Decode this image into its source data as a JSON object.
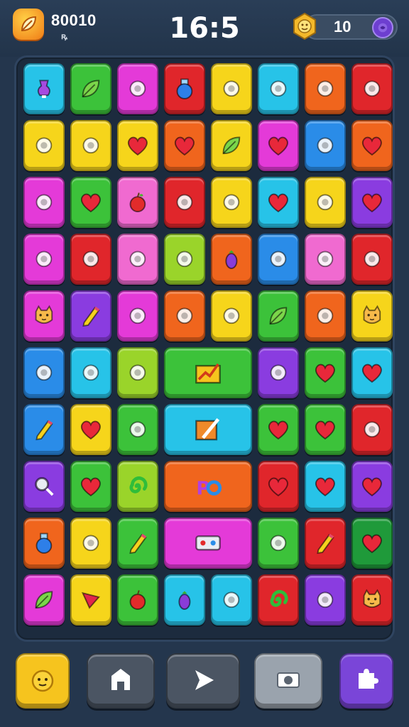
{
  "header": {
    "score": "80010",
    "score_sub": "ꝶ",
    "timer": "16:5",
    "coins": "10",
    "logo_icon": "leaf-logo-icon",
    "coin_icon": "star-medal-icon",
    "add_icon": "add-coins-icon"
  },
  "tile_colors": {
    "cyan": "#27c3e8",
    "green": "#3cc23a",
    "magenta": "#e43ad8",
    "red": "#e0262b",
    "yellow": "#f6d51b",
    "blue": "#2a8ce8",
    "orange": "#f0651d",
    "purple": "#8a3ce0",
    "pink": "#f06ad0",
    "lime": "#9ad42a",
    "gray": "#9aa3ad",
    "darkgreen": "#1f9a3a"
  },
  "grid": [
    [
      {
        "c": "cyan",
        "i": "potion-icon"
      },
      {
        "c": "green",
        "i": "leaf-icon"
      },
      {
        "c": "magenta",
        "i": "bell-pepper-icon"
      },
      {
        "c": "red",
        "i": "bottle-icon"
      },
      {
        "c": "yellow",
        "i": "clover-icon"
      },
      {
        "c": "cyan",
        "i": "boot-icon"
      },
      {
        "c": "orange",
        "i": "lime-icon"
      },
      {
        "c": "red",
        "i": "feather-icon"
      }
    ],
    [
      {
        "c": "yellow",
        "i": "lion-icon"
      },
      {
        "c": "yellow",
        "i": "bird-icon"
      },
      {
        "c": "yellow",
        "i": "heart-icon"
      },
      {
        "c": "orange",
        "i": "heart-icon"
      },
      {
        "c": "yellow",
        "i": "leaf-icon"
      },
      {
        "c": "magenta",
        "i": "heart-icon"
      },
      {
        "c": "blue",
        "i": "cake-slice-icon"
      },
      {
        "c": "orange",
        "i": "heart-icon"
      }
    ],
    [
      {
        "c": "magenta",
        "i": "brush-icon"
      },
      {
        "c": "green",
        "i": "heart-icon"
      },
      {
        "c": "pink",
        "i": "apple-icon"
      },
      {
        "c": "red",
        "i": "blueberry-icon"
      },
      {
        "c": "yellow",
        "i": "pot-icon"
      },
      {
        "c": "cyan",
        "i": "heart-icon"
      },
      {
        "c": "yellow",
        "i": "popsicle-icon"
      },
      {
        "c": "purple",
        "i": "heart-icon"
      }
    ],
    [
      {
        "c": "magenta",
        "i": "jar-icon"
      },
      {
        "c": "red",
        "i": "house-icon"
      },
      {
        "c": "pink",
        "i": "face-icon"
      },
      {
        "c": "lime",
        "i": "radish-icon"
      },
      {
        "c": "orange",
        "i": "eggplant-icon"
      },
      {
        "c": "blue",
        "i": "battery-icon"
      },
      {
        "c": "pink",
        "i": "crown-box-icon"
      },
      {
        "c": "red",
        "i": "lemon-icon"
      }
    ],
    [
      {
        "c": "magenta",
        "i": "cat-icon"
      },
      {
        "c": "purple",
        "i": "pencil-icon"
      },
      {
        "c": "magenta",
        "i": "wand-icon"
      },
      {
        "c": "orange",
        "i": "fish-icon"
      },
      {
        "c": "yellow",
        "i": "pepper-icon"
      },
      {
        "c": "green",
        "i": "leaf-icon"
      },
      {
        "c": "orange",
        "i": "phone-icon"
      },
      {
        "c": "yellow",
        "i": "cat-icon"
      }
    ],
    [
      {
        "c": "blue",
        "i": "pencils-icon"
      },
      {
        "c": "cyan",
        "i": "tablet-icon"
      },
      {
        "c": "lime",
        "i": "plum-icon"
      },
      {
        "c": "green",
        "i": "chart-icon",
        "w": 2
      },
      {
        "c": "purple",
        "i": "balloon-icon"
      },
      {
        "c": "green",
        "i": "heart-icon"
      },
      {
        "c": "cyan",
        "i": "heart-icon"
      }
    ],
    [
      {
        "c": "blue",
        "i": "pencil-icon"
      },
      {
        "c": "yellow",
        "i": "heart-icon"
      },
      {
        "c": "green",
        "i": "ruler-icon"
      },
      {
        "c": "cyan",
        "i": "drawing-icon",
        "w": 2
      },
      {
        "c": "green",
        "i": "heart-icon"
      },
      {
        "c": "green",
        "i": "heart-icon"
      },
      {
        "c": "red",
        "i": "gem-icon"
      }
    ],
    [
      {
        "c": "purple",
        "i": "magnifier-icon"
      },
      {
        "c": "green",
        "i": "heart-icon"
      },
      {
        "c": "lime",
        "i": "swirl-icon"
      },
      {
        "c": "orange",
        "i": "letters-icon",
        "w": 2
      },
      {
        "c": "red",
        "i": "heart-icon"
      },
      {
        "c": "cyan",
        "i": "heart-icon"
      },
      {
        "c": "purple",
        "i": "heart-icon"
      }
    ],
    [
      {
        "c": "orange",
        "i": "bottle-icon"
      },
      {
        "c": "yellow",
        "i": "marker-icon"
      },
      {
        "c": "green",
        "i": "pencil-icon"
      },
      {
        "c": "magenta",
        "i": "cassette-icon",
        "w": 2
      },
      {
        "c": "green",
        "i": "chili-icon"
      },
      {
        "c": "red",
        "i": "pencil-icon"
      },
      {
        "c": "darkgreen",
        "i": "heart-icon"
      }
    ],
    [
      {
        "c": "magenta",
        "i": "leaf-icon"
      },
      {
        "c": "yellow",
        "i": "triangle-icon"
      },
      {
        "c": "green",
        "i": "apple-icon"
      },
      {
        "c": "cyan",
        "i": "eggplant-icon"
      },
      {
        "c": "cyan",
        "i": "corn-icon"
      },
      {
        "c": "red",
        "i": "swirl-icon"
      },
      {
        "c": "purple",
        "i": "wizard-icon"
      },
      {
        "c": "red",
        "i": "cat-icon"
      }
    ]
  ],
  "buttons": [
    {
      "name": "creature-button",
      "color": "#f6c41e",
      "icon": "creature-icon"
    },
    {
      "name": "home-button",
      "color": "#4b5563",
      "icon": "home-icon"
    },
    {
      "name": "play-button",
      "color": "#4b5563",
      "icon": "play-icon"
    },
    {
      "name": "camera-button",
      "color": "#9aa3ad",
      "icon": "camera-icon"
    },
    {
      "name": "puzzle-button",
      "color": "#7a45d8",
      "icon": "puzzle-icon"
    }
  ]
}
